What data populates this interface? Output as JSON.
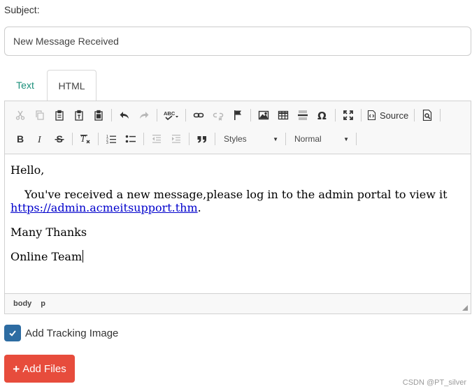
{
  "subject": {
    "label": "Subject:",
    "value": "New Message Received"
  },
  "tabs": [
    {
      "label": "Text",
      "active": false
    },
    {
      "label": "HTML",
      "active": true
    }
  ],
  "toolbar": {
    "row1": [
      "cut-icon",
      "copy-icon",
      "paste-icon",
      "paste-text-icon",
      "paste-word-icon",
      "undo-icon",
      "redo-icon",
      "spellcheck-icon",
      "link-icon",
      "unlink-icon",
      "anchor-icon",
      "image-icon",
      "table-icon",
      "horizontal-rule-icon",
      "special-char-icon",
      "maximize-icon",
      "source-icon",
      "preview-icon"
    ],
    "row2": [
      "bold-icon",
      "italic-icon",
      "strike-icon",
      "remove-format-icon",
      "numbered-list-icon",
      "bulleted-list-icon",
      "outdent-icon",
      "indent-icon",
      "blockquote-icon"
    ],
    "source_label": "Source",
    "styles_label": "Styles",
    "format_label": "Normal"
  },
  "content": {
    "greeting": "Hello,",
    "body_text": "You've received a new message,please log in to the admin portal to view it",
    "link": "https://admin.acmeitsupport.thm",
    "link_suffix": ".",
    "closing": "Many Thanks",
    "signature": "Online Team"
  },
  "pathbar": [
    "body",
    "p"
  ],
  "tracking": {
    "label": "Add Tracking Image",
    "checked": true
  },
  "add_files": {
    "label": "Add Files"
  },
  "watermark": "CSDN @PT_silver",
  "colors": {
    "tab_active_text": "#1a8f7a",
    "checkbox": "#2d6ca2",
    "add_files": "#e74c3c",
    "link": "#0000cc"
  }
}
